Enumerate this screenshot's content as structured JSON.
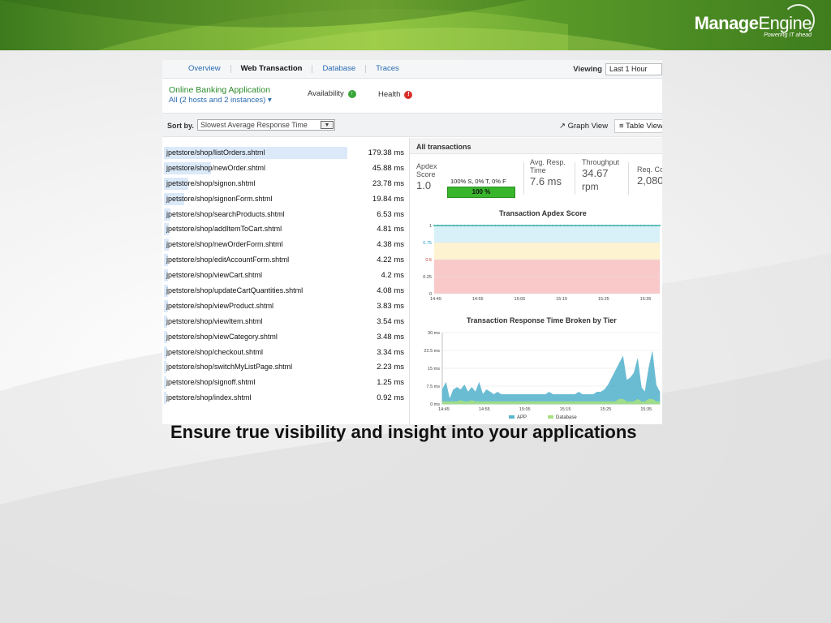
{
  "brand": {
    "logo_bold": "Manage",
    "logo_light": "Engine",
    "tagline": "Powering IT ahead"
  },
  "tabs": [
    {
      "label": "Overview",
      "active": false
    },
    {
      "label": "Web Transaction",
      "active": true
    },
    {
      "label": "Database",
      "active": false
    },
    {
      "label": "Traces",
      "active": false
    }
  ],
  "viewing": {
    "label": "Viewing",
    "value": "Last 1 Hour"
  },
  "application": {
    "name": "Online Banking Application",
    "hosts": "All (2 hosts and 2 instances) ▾",
    "availability_label": "Availability",
    "health_label": "Health"
  },
  "sort": {
    "label": "Sort by.",
    "value": "Slowest Average Response Time",
    "arrow": "▼"
  },
  "views": {
    "graph": "Graph View",
    "graph_icon": "↗",
    "table": "Table View",
    "table_icon": "≡"
  },
  "transactions": [
    {
      "url": "jpetstore/shop/listOrders.shtml",
      "time": "179.38 ms",
      "ms": 179.38
    },
    {
      "url": "jpetstore/shop/newOrder.shtml",
      "time": "45.88 ms",
      "ms": 45.88
    },
    {
      "url": "jpetstore/shop/signon.shtml",
      "time": "23.78 ms",
      "ms": 23.78
    },
    {
      "url": "jpetstore/shop/signonForm.shtml",
      "time": "19.84 ms",
      "ms": 19.84
    },
    {
      "url": "jpetstore/shop/searchProducts.shtml",
      "time": "6.53 ms",
      "ms": 6.53
    },
    {
      "url": "jpetstore/shop/addItemToCart.shtml",
      "time": "4.81 ms",
      "ms": 4.81
    },
    {
      "url": "jpetstore/shop/newOrderForm.shtml",
      "time": "4.38 ms",
      "ms": 4.38
    },
    {
      "url": "jpetstore/shop/editAccountForm.shtml",
      "time": "4.22 ms",
      "ms": 4.22
    },
    {
      "url": "jpetstore/shop/viewCart.shtml",
      "time": "4.2 ms",
      "ms": 4.2
    },
    {
      "url": "jpetstore/shop/updateCartQuantities.shtml",
      "time": "4.08 ms",
      "ms": 4.08
    },
    {
      "url": "jpetstore/shop/viewProduct.shtml",
      "time": "3.83 ms",
      "ms": 3.83
    },
    {
      "url": "jpetstore/shop/viewItem.shtml",
      "time": "3.54 ms",
      "ms": 3.54
    },
    {
      "url": "jpetstore/shop/viewCategory.shtml",
      "time": "3.48 ms",
      "ms": 3.48
    },
    {
      "url": "jpetstore/shop/checkout.shtml",
      "time": "3.34 ms",
      "ms": 3.34
    },
    {
      "url": "jpetstore/shop/switchMyListPage.shtml",
      "time": "2.23 ms",
      "ms": 2.23
    },
    {
      "url": "jpetstore/shop/signoff.shtml",
      "time": "1.25 ms",
      "ms": 1.25
    },
    {
      "url": "jpetstore/shop/index.shtml",
      "time": "0.92 ms",
      "ms": 0.92
    }
  ],
  "summary": {
    "header": "All transactions",
    "apdex_label": "Apdex Score",
    "apdex_value": "1.0",
    "apdex_breakdown": "100% S, 0% T, 0% F",
    "apdex_bar": "100 %",
    "resp_label": "Avg. Resp. Time",
    "resp_value": "7.6 ms",
    "throughput_label": "Throughput",
    "throughput_value": "34.67",
    "throughput_unit": "rpm",
    "req_label": "Req. Co",
    "req_value": "2,080"
  },
  "chart_data": [
    {
      "type": "line",
      "title": "Transaction Apdex Score",
      "x_ticks": [
        "14:45",
        "14:55",
        "15:05",
        "15:15",
        "15:25",
        "15:35"
      ],
      "y_ticks": [
        "0",
        "0.25",
        "0.5",
        "0.75",
        "1"
      ],
      "ylim": [
        0,
        1
      ],
      "zones": [
        {
          "from": 0,
          "to": 0.5,
          "color": "#f9c8c8"
        },
        {
          "from": 0.5,
          "to": 0.75,
          "color": "#fdf3d0"
        },
        {
          "from": 0.75,
          "to": 1,
          "color": "#d8f1f9"
        }
      ],
      "series": [
        {
          "values": [
            1,
            1,
            1,
            1,
            1,
            1,
            1,
            1,
            1,
            1,
            1,
            1,
            1,
            1,
            1,
            1,
            1,
            1,
            1,
            1,
            1,
            1,
            1,
            1,
            1,
            1,
            1,
            1,
            1,
            1,
            1,
            1,
            1,
            1,
            1,
            1,
            1,
            1,
            1,
            1,
            1,
            1,
            1,
            1,
            1,
            1,
            1,
            1,
            1,
            1,
            1,
            1,
            1,
            1,
            1,
            1,
            1,
            1,
            1,
            1
          ],
          "color": "#1aa39a"
        }
      ]
    },
    {
      "type": "area",
      "title": "Transaction Response Time Broken by Tier",
      "x_ticks": [
        "14:45",
        "14:55",
        "15:05",
        "15:15",
        "15:25",
        "15:35"
      ],
      "y_ticks": [
        "0 ms",
        "7.5 ms",
        "15 ms",
        "22.5 ms",
        "30 ms"
      ],
      "ylim": [
        0,
        30
      ],
      "series": [
        {
          "name": "APP",
          "color": "#5ab5cf",
          "values": [
            6,
            9,
            2,
            6,
            7,
            6,
            8,
            5,
            7,
            5,
            9,
            4,
            6,
            5,
            4,
            5,
            4,
            4,
            4,
            4,
            4,
            4,
            4,
            4,
            4,
            4,
            4,
            4,
            4,
            5,
            4,
            4,
            4,
            4,
            4,
            4,
            4,
            5,
            4,
            4,
            4,
            4,
            5,
            5,
            6,
            8,
            11,
            14,
            17,
            20,
            10,
            11,
            13,
            19,
            7,
            5,
            15,
            22,
            8,
            5
          ]
        },
        {
          "name": "Database",
          "color": "#a6e083",
          "values": [
            1,
            1,
            1,
            1,
            1,
            1.5,
            1,
            1,
            1.5,
            1,
            1,
            1,
            1,
            1,
            1,
            1,
            1,
            1,
            1,
            1,
            1,
            1,
            1,
            1,
            1,
            1,
            1,
            1,
            1,
            1,
            1,
            1,
            1,
            1,
            1,
            1,
            1,
            1,
            1,
            1,
            1,
            1,
            1,
            1,
            1,
            1,
            1,
            1,
            2,
            2,
            1,
            1,
            1,
            2,
            1,
            1,
            2,
            2,
            1,
            1
          ]
        }
      ]
    }
  ],
  "caption": "Ensure true visibility and insight into your applications"
}
